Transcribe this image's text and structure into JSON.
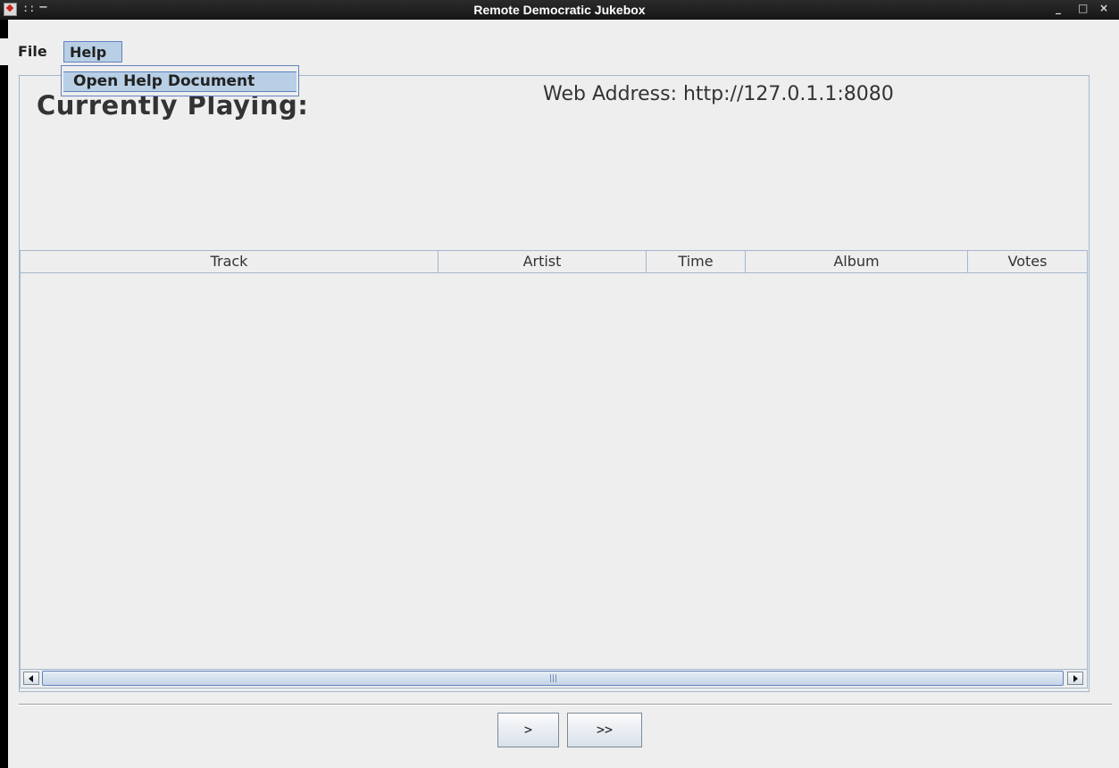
{
  "window": {
    "title": "Remote Democratic Jukebox",
    "controls": {
      "grip": "::",
      "dash": "−",
      "minimize": "_",
      "maximize": "□",
      "close": "×"
    }
  },
  "menubar": {
    "items": [
      {
        "label": "File",
        "active": false
      },
      {
        "label": "Help",
        "active": true
      }
    ]
  },
  "help_menu": {
    "items": [
      {
        "label": "Open Help Document"
      }
    ]
  },
  "main": {
    "currently_playing_label": "Currently Playing:",
    "web_address_text": "Web Address: http://127.0.1.1:8080"
  },
  "table": {
    "columns": [
      {
        "label": "Track"
      },
      {
        "label": "Artist"
      },
      {
        "label": "Time"
      },
      {
        "label": "Album"
      },
      {
        "label": "Votes"
      }
    ],
    "rows": []
  },
  "controls": {
    "play_label": ">",
    "skip_label": ">>"
  },
  "colors": {
    "titlebar": "#1e1e1e",
    "background": "#eeeeee",
    "selection": "#b8cfe5",
    "border_accent": "#6382bf"
  },
  "icons": [
    "app-icon",
    "scroll-left-icon",
    "scroll-right-icon"
  ]
}
